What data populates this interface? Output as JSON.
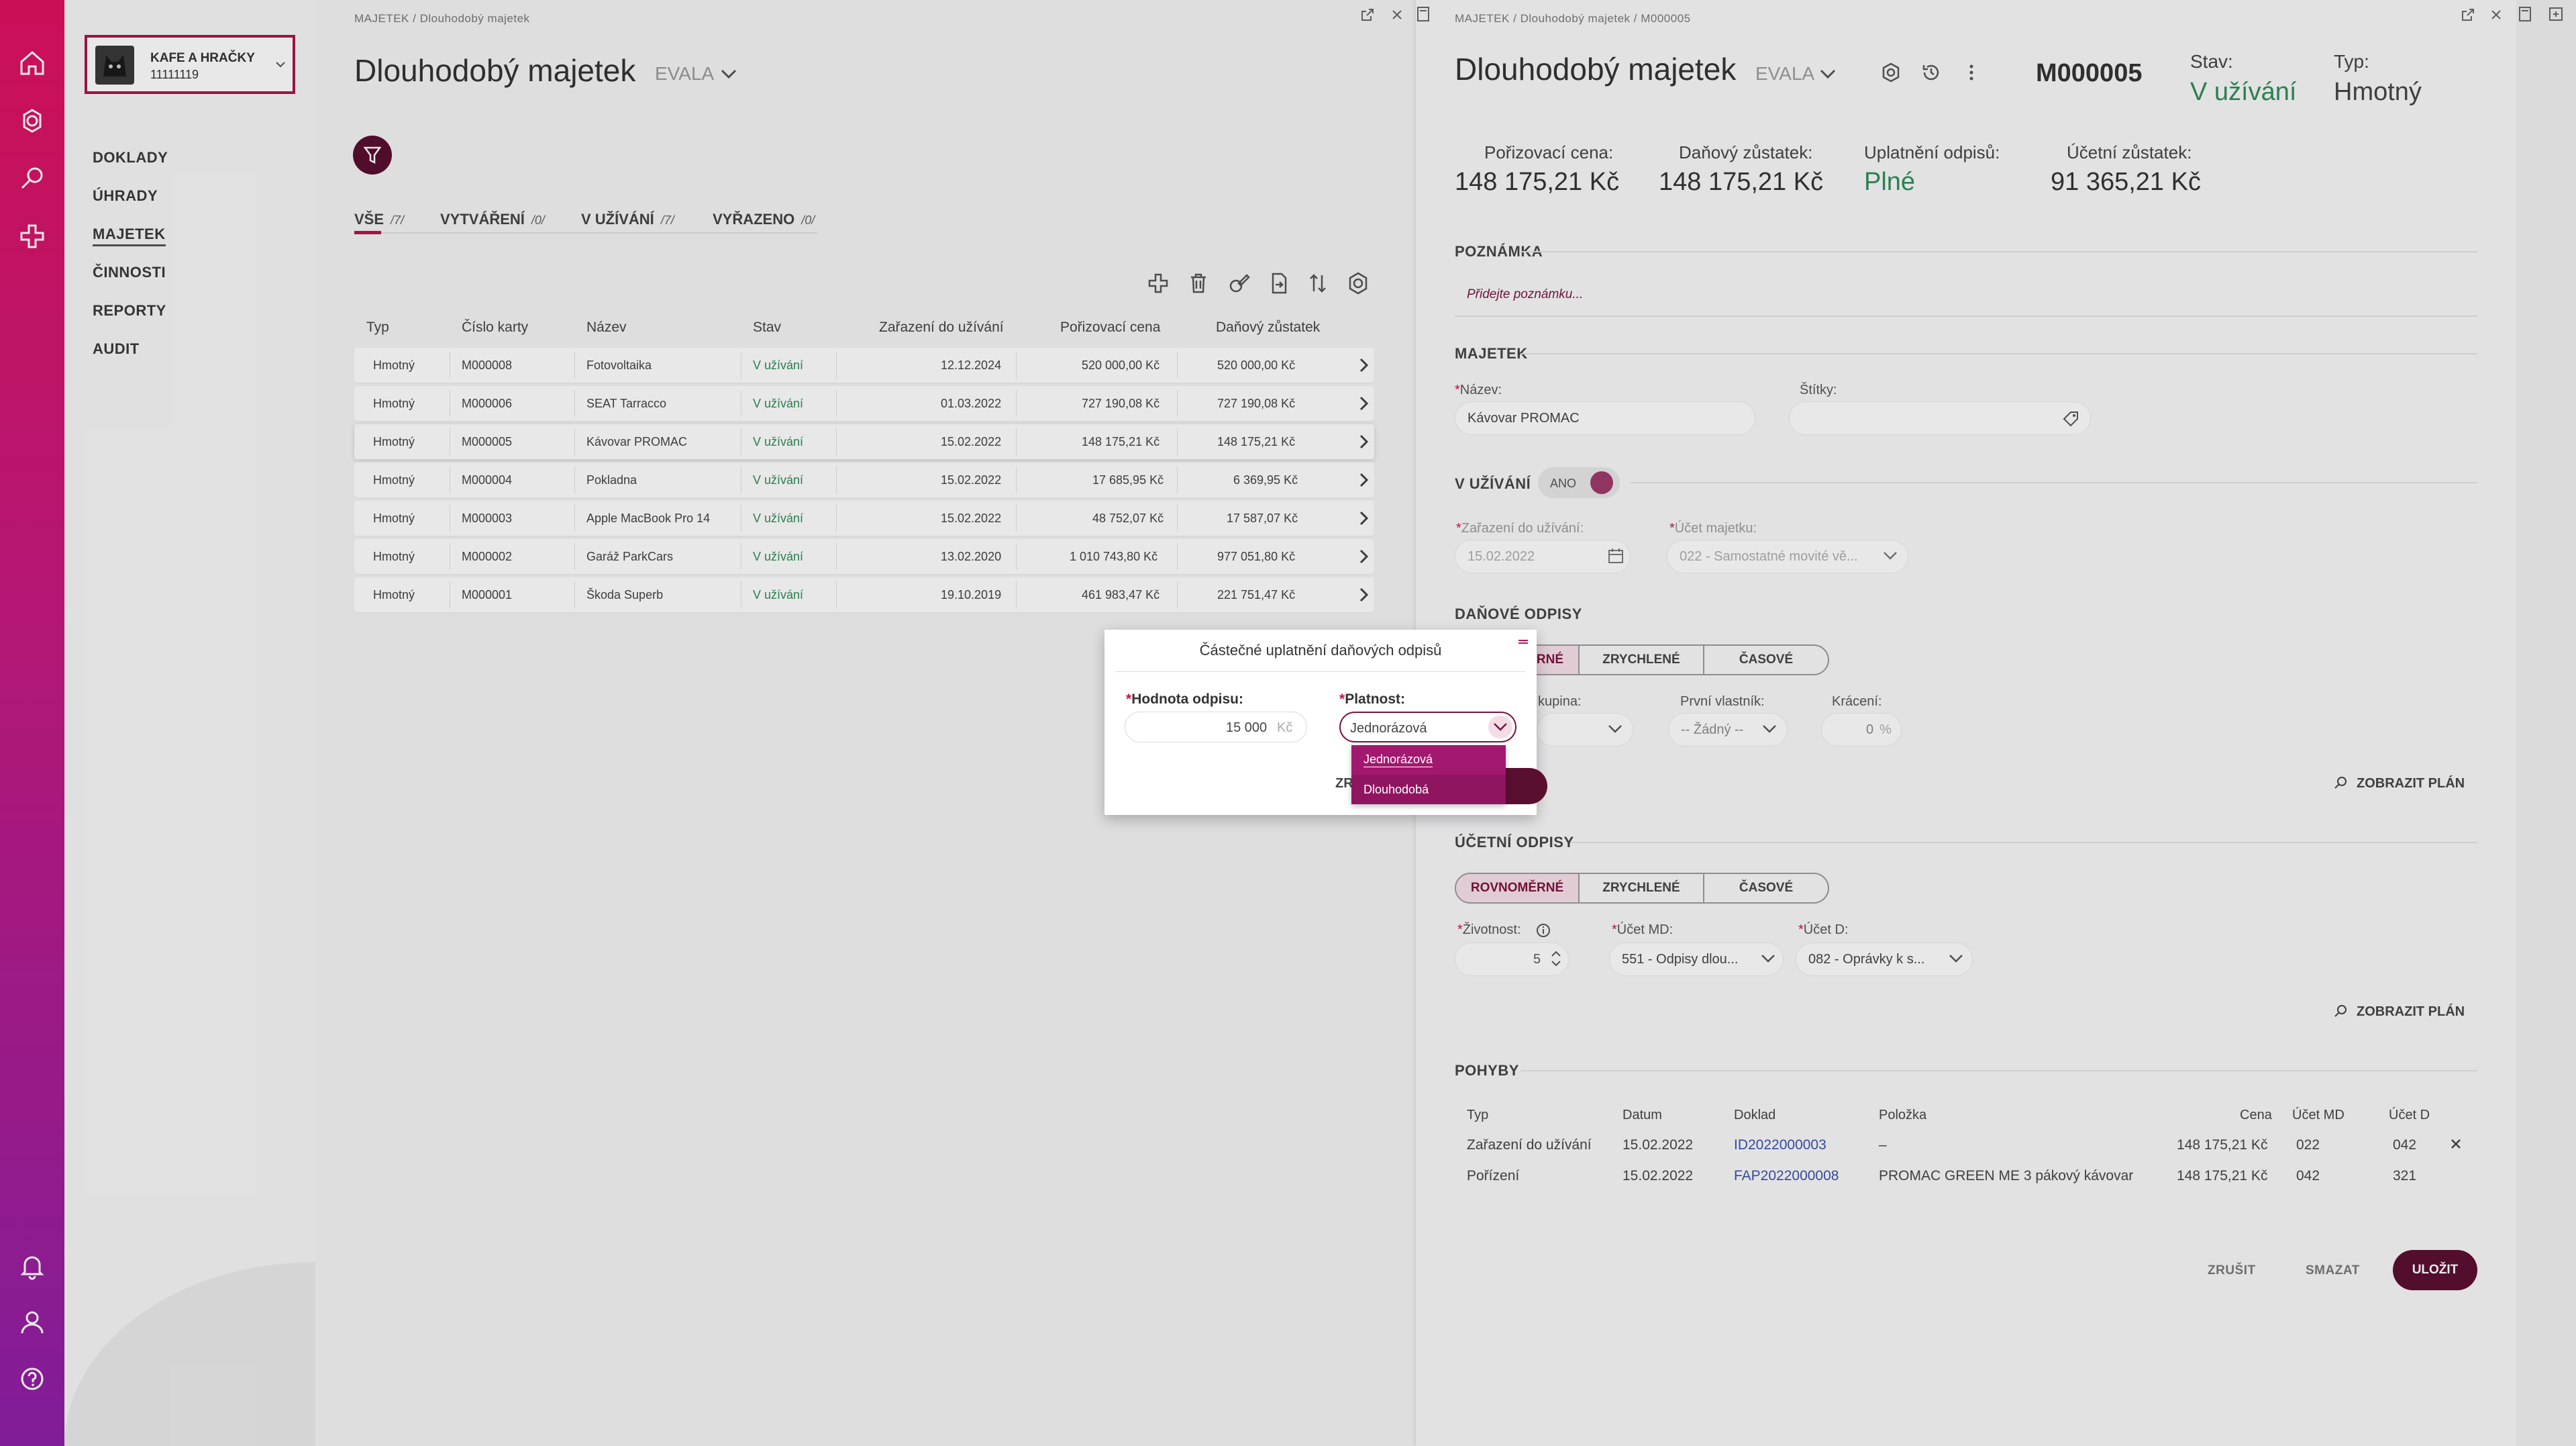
{
  "company": {
    "name": "KAFE A HRAČKY",
    "id": "11111119"
  },
  "nav": [
    "DOKLADY",
    "ÚHRADY",
    "MAJETEK",
    "ČINNOSTI",
    "REPORTY",
    "AUDIT"
  ],
  "nav_active": "MAJETEK",
  "left": {
    "breadcrumb": "MAJETEK  /  Dlouhodobý majetek",
    "title": "Dlouhodobý majetek",
    "subtitle": "EVALA",
    "tabs": [
      {
        "label": "VŠE",
        "count": "/7/"
      },
      {
        "label": "VYTVÁŘENÍ",
        "count": "/0/"
      },
      {
        "label": "V UŽÍVÁNÍ",
        "count": "/7/"
      },
      {
        "label": "VYŘAZENO",
        "count": "/0/"
      }
    ],
    "columns": [
      "Typ",
      "Číslo karty",
      "Název",
      "Stav",
      "Zařazení do užívání",
      "Pořizovací cena",
      "Daňový zůstatek"
    ],
    "rows": [
      [
        "Hmotný",
        "M000008",
        "Fotovoltaika",
        "V užívání",
        "12.12.2024",
        "520 000,00 Kč",
        "520 000,00 Kč"
      ],
      [
        "Hmotný",
        "M000006",
        "SEAT Tarracco",
        "V užívání",
        "01.03.2022",
        "727 190,08 Kč",
        "727 190,08 Kč"
      ],
      [
        "Hmotný",
        "M000005",
        "Kávovar PROMAC",
        "V užívání",
        "15.02.2022",
        "148 175,21 Kč",
        "148 175,21 Kč"
      ],
      [
        "Hmotný",
        "M000004",
        "Pokladna",
        "V užívání",
        "15.02.2022",
        "17 685,95 Kč",
        "6 369,95 Kč"
      ],
      [
        "Hmotný",
        "M000003",
        "Apple MacBook Pro 14",
        "V užívání",
        "15.02.2022",
        "48 752,07 Kč",
        "17 587,07 Kč"
      ],
      [
        "Hmotný",
        "M000002",
        "Garáž ParkCars",
        "V užívání",
        "13.02.2020",
        "1 010 743,80 Kč",
        "977 051,80 Kč"
      ],
      [
        "Hmotný",
        "M000001",
        "Škoda Superb",
        "V užívání",
        "19.10.2019",
        "461 983,47 Kč",
        "221 751,47 Kč"
      ]
    ]
  },
  "right": {
    "breadcrumb": "MAJETEK  /  Dlouhodobý majetek  /  M000005",
    "title": "Dlouhodobý majetek",
    "subtitle": "EVALA",
    "card_no": "M000005",
    "status_label": "Stav:",
    "status_value": "V užívání",
    "type_label": "Typ:",
    "type_value": "Hmotný",
    "summary": [
      {
        "label": "Pořizovací cena:",
        "value": "148 175,21 Kč"
      },
      {
        "label": "Daňový zůstatek:",
        "value": "148 175,21 Kč"
      },
      {
        "label": "Uplatnění odpisů:",
        "value": "Plné"
      },
      {
        "label": "Účetní zůstatek:",
        "value": "91 365,21 Kč"
      }
    ],
    "note_header": "POZNÁMKA",
    "note_placeholder": "Přidejte poznámku...",
    "asset_header": "MAJETEK",
    "name_label": "Název:",
    "name_value": "Kávovar PROMAC",
    "tags_label": "Štítky:",
    "inuse_header": "V UŽÍVÁNÍ",
    "inuse_toggle": "ANO",
    "inuse_date_label": "Zařazení do užívání:",
    "inuse_date_value": "15.02.2022",
    "account_label": "Účet majetku:",
    "account_value": "022 - Samostatné movité vě...",
    "tax_header": "DAŇOVÉ ODPISY",
    "tax_seg": [
      "RNÉ",
      "ZRYCHLENÉ",
      "ČASOVÉ"
    ],
    "tax_group_label": "kupina:",
    "first_owner_label": "První vlastník:",
    "first_owner_value": "-- Žádný --",
    "reduction_label": "Krácení:",
    "reduction_value": "0",
    "reduction_unit": "%",
    "show_plan": "ZOBRAZIT PLÁN",
    "acc_header": "ÚČETNÍ ODPISY",
    "acc_seg": [
      "ROVNOMĚRNÉ",
      "ZRYCHLENÉ",
      "ČASOVÉ"
    ],
    "life_label": "Životnost:",
    "life_value": "5",
    "md_label": "Účet MD:",
    "md_value": "551 - Odpisy dlou...",
    "d_label": "Účet D:",
    "d_value": "082 - Oprávky k s...",
    "moves_header": "POHYBY",
    "moves_columns": [
      "Typ",
      "Datum",
      "Doklad",
      "Položka",
      "Cena",
      "Účet MD",
      "Účet D"
    ],
    "moves": [
      [
        "Zařazení do užívání",
        "15.02.2022",
        "ID2022000003",
        "–",
        "148 175,21 Kč",
        "022",
        "042"
      ],
      [
        "Pořízení",
        "15.02.2022",
        "FAP2022000008",
        "PROMAC GREEN ME 3 pákový kávovar",
        "148 175,21 Kč",
        "042",
        "321"
      ]
    ],
    "btn_cancel": "ZRUŠIT",
    "btn_delete": "SMAZAT",
    "btn_save": "ULOŽIT"
  },
  "modal": {
    "title": "Částečné uplatnění daňových odpisů",
    "amount_label": "Hodnota odpisu:",
    "amount_value": "15 000",
    "amount_unit": "Kč",
    "validity_label": "Platnost:",
    "validity_value": "Jednorázová",
    "options": [
      "Jednorázová",
      "Dlouhodobá"
    ],
    "hidden_btn_fragment": "ZR"
  },
  "colors": {
    "accent": "#5a0f31",
    "brand_gradient_top": "#e0115f",
    "brand_gradient_bottom": "#8e20a8",
    "status_green": "#2e8b57",
    "dropdown": "#a3186f"
  }
}
